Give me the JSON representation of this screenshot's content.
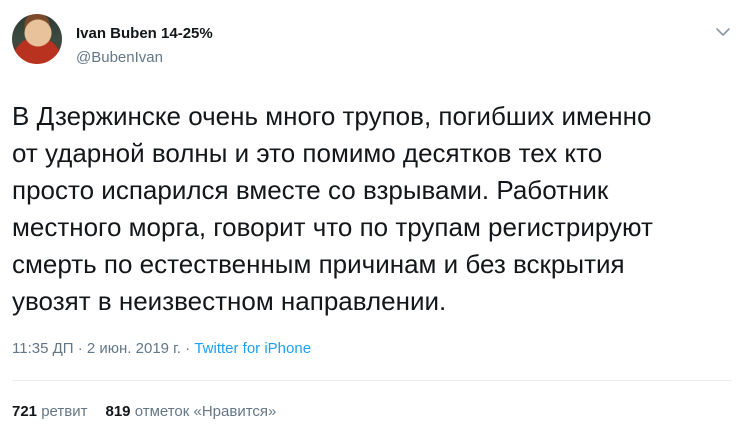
{
  "author": {
    "name": "Ivan Buben 14-25%",
    "handle": "@BubenIvan"
  },
  "tweet": {
    "lines": [
      "В Дзержинске очень много трупов, погибших именно",
      "от ударной волны и это помимо десятков тех кто",
      "просто испарился вместе со взрывами. Работник",
      "местного морга, говорит что по трупам регистрируют",
      "смерть по естественным причинам и без вскрытия",
      "увозят в неизвестном направлении."
    ]
  },
  "meta": {
    "time": "11:35 ДП",
    "sep1": " · ",
    "date": "2 июн. 2019 г.",
    "sep2": " · ",
    "source": "Twitter for iPhone"
  },
  "stats": {
    "retweets_count": "721",
    "retweets_label": "ретвит",
    "likes_count": "819",
    "likes_label": "отметок «Нравится»"
  },
  "icons": {
    "menu": "chevron-down-icon"
  },
  "colors": {
    "text": "#14171a",
    "secondary": "#657786",
    "link": "#1da1f2",
    "divider": "#e6ecf0"
  }
}
